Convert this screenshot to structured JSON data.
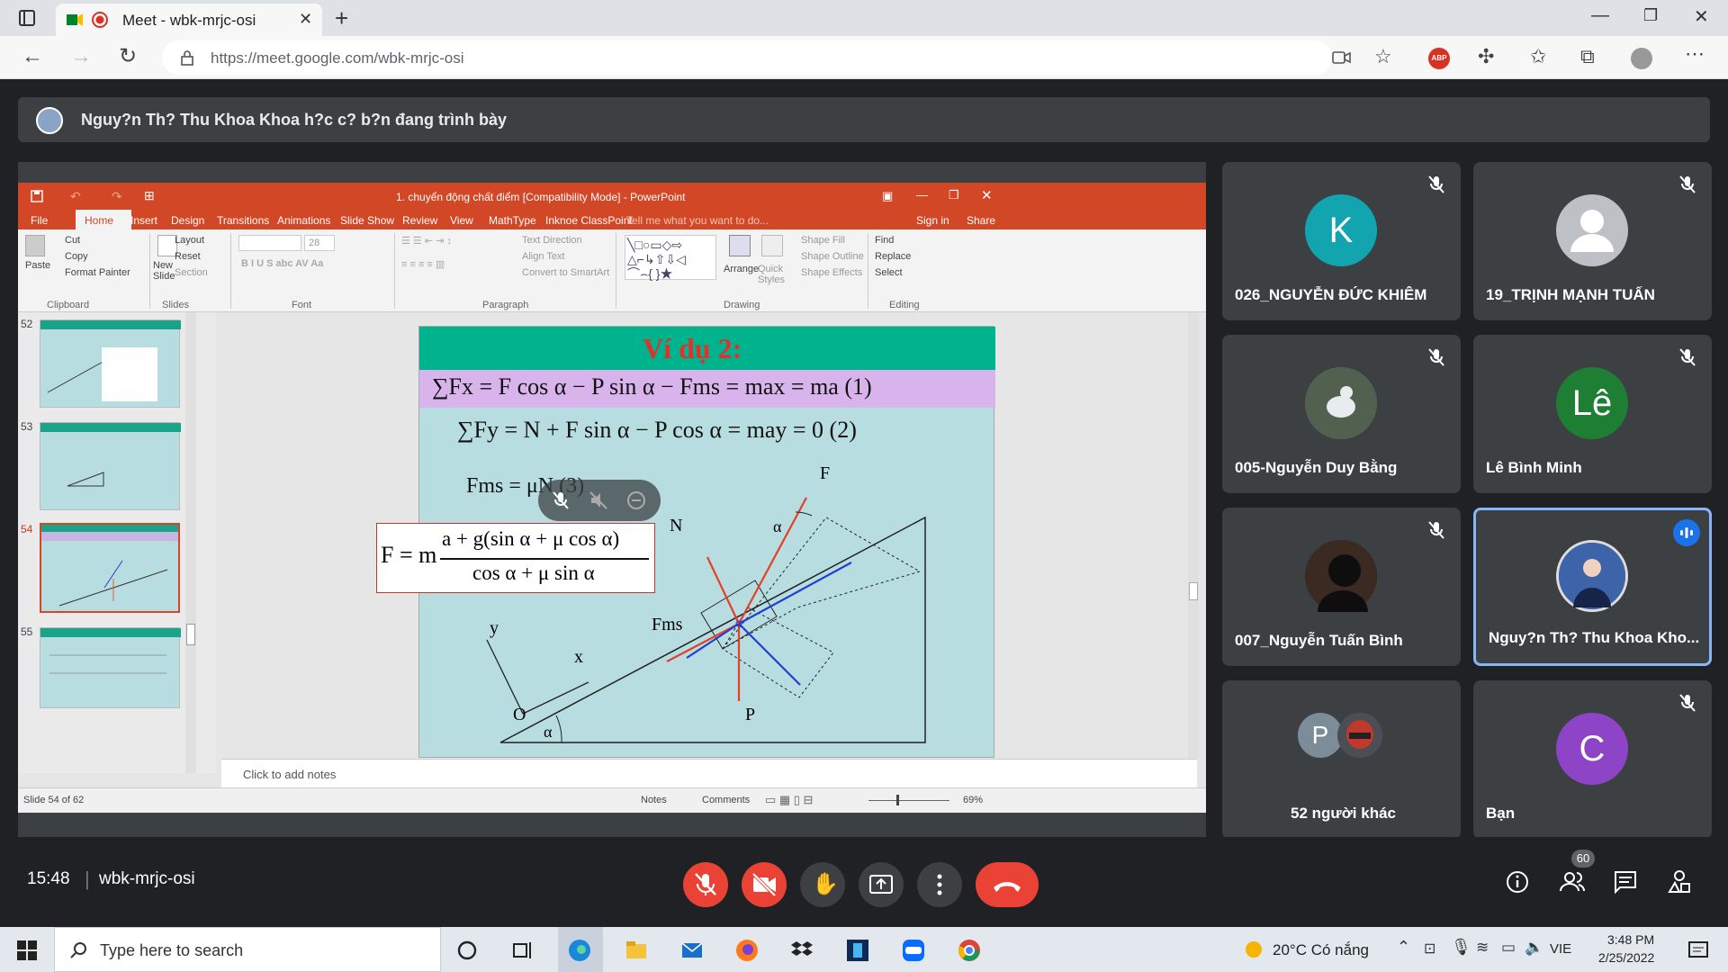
{
  "browser": {
    "tab_title": "Meet - wbk-mrjc-osi",
    "url": "https://meet.google.com/wbk-mrjc-osi",
    "abp_label": "ABP"
  },
  "meet": {
    "presenting_banner": "Nguy?n Th? Thu Khoa Khoa h?c c? b?n đang trình bày",
    "time": "15:48",
    "meeting_code": "wbk-mrjc-osi",
    "participant_count": "60",
    "tiles": [
      {
        "name": "026_NGUYỄN ĐỨC KHIÊM",
        "initial": "K",
        "color": "#12a4af"
      },
      {
        "name": "19_TRỊNH MẠNH TUẤN",
        "initial": "",
        "color": "#bdc1c6"
      },
      {
        "name": "005-Nguyễn Duy Bằng",
        "initial": "",
        "color": "#5d6b58"
      },
      {
        "name": "Lê Bình Minh",
        "initial": "Lê",
        "color": "#1e7e34"
      },
      {
        "name": "007_Nguyễn Tuấn Bình",
        "initial": "",
        "color": "#1a1a1a"
      },
      {
        "name": "Nguy?n Th? Thu Khoa Kho...",
        "initial": "",
        "color": "#2b4c8a"
      },
      {
        "name": "52 người khác",
        "initial": "P",
        "color": "#7c8c98"
      },
      {
        "name": "Bạn",
        "initial": "C",
        "color": "#8e44c7"
      }
    ]
  },
  "ppt": {
    "window_title": "1. chuyển động chất điểm [Compatibility Mode] - PowerPoint",
    "tabs": [
      "File",
      "Home",
      "Insert",
      "Design",
      "Transitions",
      "Animations",
      "Slide Show",
      "Review",
      "View",
      "MathType",
      "Inknoe ClassPoint"
    ],
    "tell_me": "Tell me what you want to do...",
    "sign_in": "Sign in",
    "share": "Share",
    "ribbon": {
      "paste": "Paste",
      "cut": "Cut",
      "copy": "Copy",
      "format_painter": "Format Painter",
      "new_slide": "New Slide",
      "layout": "Layout",
      "reset": "Reset",
      "section": "Section",
      "font_size": "28",
      "text_direction": "Text Direction",
      "align_text": "Align Text",
      "convert_smartart": "Convert to SmartArt",
      "arrange": "Arrange",
      "quick_styles": "Quick Styles",
      "shape_fill": "Shape Fill",
      "shape_outline": "Shape Outline",
      "shape_effects": "Shape Effects",
      "find": "Find",
      "replace": "Replace",
      "select": "Select",
      "groups": [
        "Clipboard",
        "Slides",
        "Font",
        "Paragraph",
        "Drawing",
        "Editing"
      ]
    },
    "thumb_numbers": [
      "52",
      "53",
      "54",
      "55"
    ],
    "notes_placeholder": "Click to add notes",
    "status": {
      "slide_info": "Slide 54 of 62",
      "notes": "Notes",
      "comments": "Comments",
      "zoom": "69%"
    },
    "slide": {
      "title": "Ví dụ 2:",
      "eq1": "∑Fx = F cos α − P sin α − Fms = max = ma    (1)",
      "eq2": "∑Fy = N + F sin α − P cos α = may = 0    (2)",
      "eq3": "Fms = μN    (3)",
      "result_lhs": "F = m",
      "result_num": "a + g(sin α + μ cos α)",
      "result_den": "cos α + μ sin α",
      "label_N": "N",
      "label_F": "F",
      "label_P": "P",
      "label_Fms": "Fms",
      "label_alpha": "α",
      "label_alpha2": "α",
      "label_x": "x",
      "label_y": "y",
      "label_O": "O"
    }
  },
  "taskbar": {
    "search_placeholder": "Type here to search",
    "weather": "20°C  Có nắng",
    "lang": "VIE",
    "time": "3:48 PM",
    "date": "2/25/2022"
  }
}
